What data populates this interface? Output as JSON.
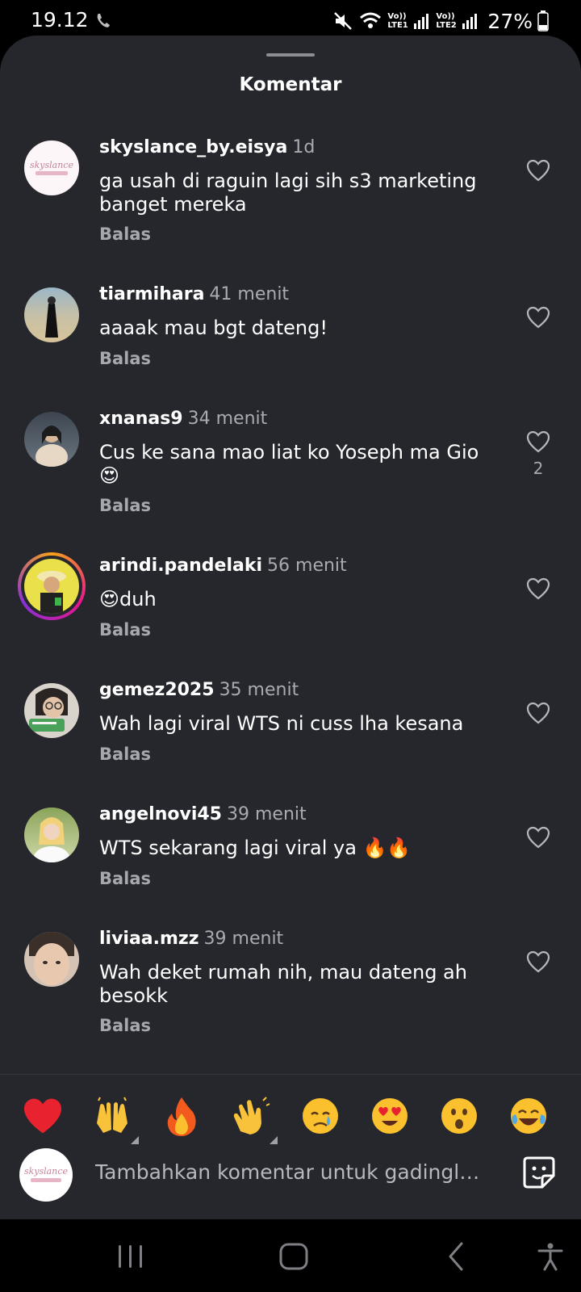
{
  "status_bar": {
    "time": "19.12",
    "network_labels": [
      "Vo)) LTE1",
      "Vo)) LTE2"
    ],
    "battery": "27%",
    "icons": [
      "call-icon",
      "mute-icon",
      "wifi-icon",
      "signal-icon",
      "battery-icon"
    ]
  },
  "sheet": {
    "title": "Komentar"
  },
  "comments": [
    {
      "username": "skyslance_by.eisya",
      "time": "1d",
      "text": "ga usah di raguin lagi sih s3 marketing banget mereka",
      "reply": "Balas",
      "likes": ""
    },
    {
      "username": "tiarmihara",
      "time": "41 menit",
      "text": "aaaak mau bgt dateng!",
      "reply": "Balas",
      "likes": ""
    },
    {
      "username": "xnanas9",
      "time": "34 menit",
      "text": "Cus ke sana mao liat ko Yoseph ma Gio 😍",
      "reply": "Balas",
      "likes": "2"
    },
    {
      "username": "arindi.pandelaki",
      "time": "56 menit",
      "text": "😍duh",
      "reply": "Balas",
      "likes": ""
    },
    {
      "username": "gemez2025",
      "time": "35 menit",
      "text": "Wah lagi viral WTS ni cuss lha kesana",
      "reply": "Balas",
      "likes": ""
    },
    {
      "username": "angelnovi45",
      "time": "39 menit",
      "text": "WTS sekarang lagi viral ya 🔥🔥",
      "reply": "Balas",
      "likes": ""
    },
    {
      "username": "liviaa.mzz",
      "time": "39 menit",
      "text": "Wah deket rumah nih, mau dateng ah besokk",
      "reply": "Balas",
      "likes": ""
    }
  ],
  "emoji_bar": [
    "red-heart",
    "raising-hands",
    "fire",
    "clapping-hands",
    "crying-face",
    "heart-eyes",
    "surprised-face",
    "tears-of-joy"
  ],
  "input": {
    "placeholder": "Tambahkan komentar untuk gadinglyfe..."
  },
  "colors": {
    "sheet_bg": "#25272c",
    "secondary_text": "#a9abb0",
    "accent_ring": "#e5178d"
  }
}
